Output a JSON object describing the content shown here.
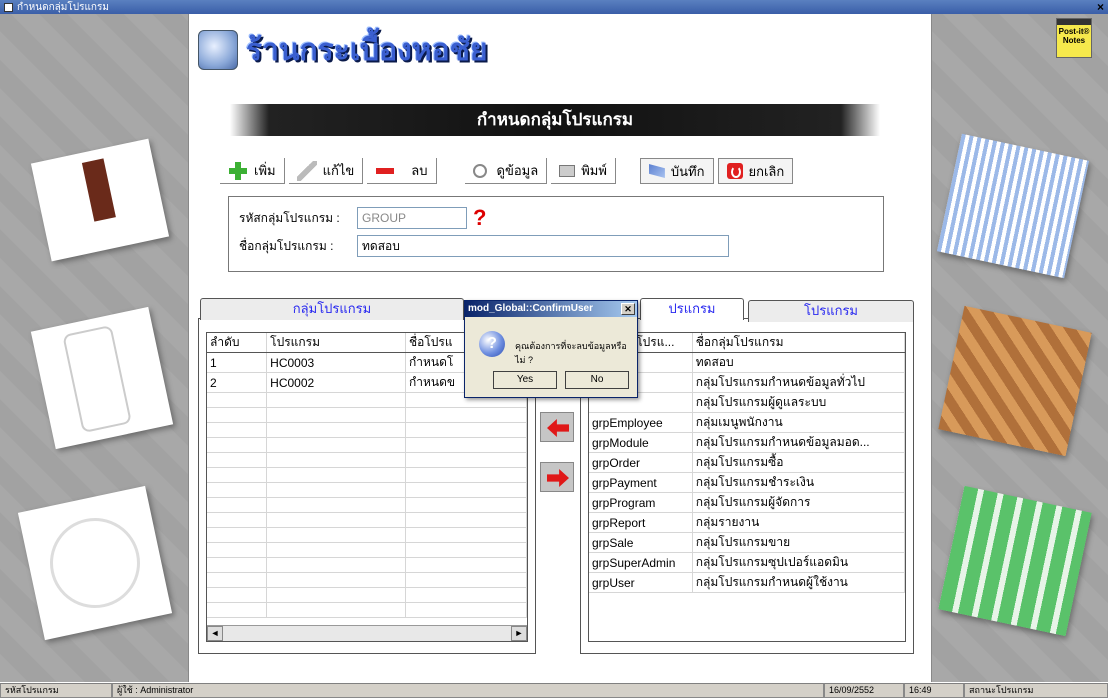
{
  "window": {
    "title": "กำหนดกลุ่มโปรแกรม"
  },
  "postit": {
    "label": "Post-it® Notes"
  },
  "header": {
    "logo_text": "ร้านกระเบื้องหอชัย",
    "banner_title": "กำหนดกลุ่มโปรแกรม"
  },
  "toolbar": {
    "add": "เพิ่ม",
    "edit": "แก้ไข",
    "delete": "ลบ",
    "view": "ดูข้อมูล",
    "print": "พิมพ์",
    "save": "บันทึก",
    "cancel": "ยกเลิก"
  },
  "form": {
    "group_code_label": "รหัสกลุ่มโปรแกรม :",
    "group_code_value": "GROUP",
    "group_name_label": "ชื่อกลุ่มโปรแกรม :",
    "group_name_value": "ทดสอบ",
    "help_glyph": "?"
  },
  "left_panel": {
    "tab_label": "กลุ่มโปรแกรม",
    "columns": [
      "ลำดับ",
      "โปรแกรม",
      "ชื่อโปรแ"
    ],
    "rows": [
      [
        "1",
        "HC0003",
        "กำหนดโ"
      ],
      [
        "2",
        "HC0002",
        "กำหนดข"
      ]
    ]
  },
  "right_panel": {
    "tab_group_label": "ปรแกรม",
    "tab_program_label": "โปรแกรม",
    "columns": [
      "รหัสกลุ่มโปรแ...",
      "ชื่อกลุ่มโปรแกรม"
    ],
    "rows": [
      [
        "",
        "ทดสอบ"
      ],
      [
        "a",
        "กลุ่มโปรแกรมกำหนดข้อมูลทั่วไป"
      ],
      [
        "",
        "กลุ่มโปรแกรมผู้ดูแลระบบ"
      ],
      [
        "grpEmployee",
        "กลุ่มเมนูพนักงาน"
      ],
      [
        "grpModule",
        "กลุ่มโปรแกรมกำหนดข้อมูลมอด..."
      ],
      [
        "grpOrder",
        "กลุ่มโปรแกรมซื้อ"
      ],
      [
        "grpPayment",
        "กลุ่มโปรแกรมชำระเงิน"
      ],
      [
        "grpProgram",
        "กลุ่มโปรแกรมผู้จัดการ"
      ],
      [
        "grpReport",
        "กลุ่มรายงาน"
      ],
      [
        "grpSale",
        "กลุ่มโปรแกรมขาย"
      ],
      [
        "grpSuperAdmin",
        "กลุ่มโปรแกรมซุปเปอร์แอดมิน"
      ],
      [
        "grpUser",
        "กลุ่มโปรแกรมกำหนดผู้ใช้งาน"
      ]
    ]
  },
  "dialog": {
    "title": "mod_Global::ConfirmUser",
    "message": "คุณต้องการที่จะลบข้อมูลหรือไม่ ?",
    "yes": "Yes",
    "no": "No"
  },
  "statusbar": {
    "left": "รหัสโปรแกรม",
    "user": "ผู้ใช้ : Administrator",
    "date": "16/09/2552",
    "time": "16:49",
    "state": "สถานะโปรแกรม"
  },
  "colors": {
    "accent": "#2a2af0",
    "title_bar": "#3a5ea8",
    "delete_red": "#e02020",
    "add_green": "#3cb034"
  }
}
